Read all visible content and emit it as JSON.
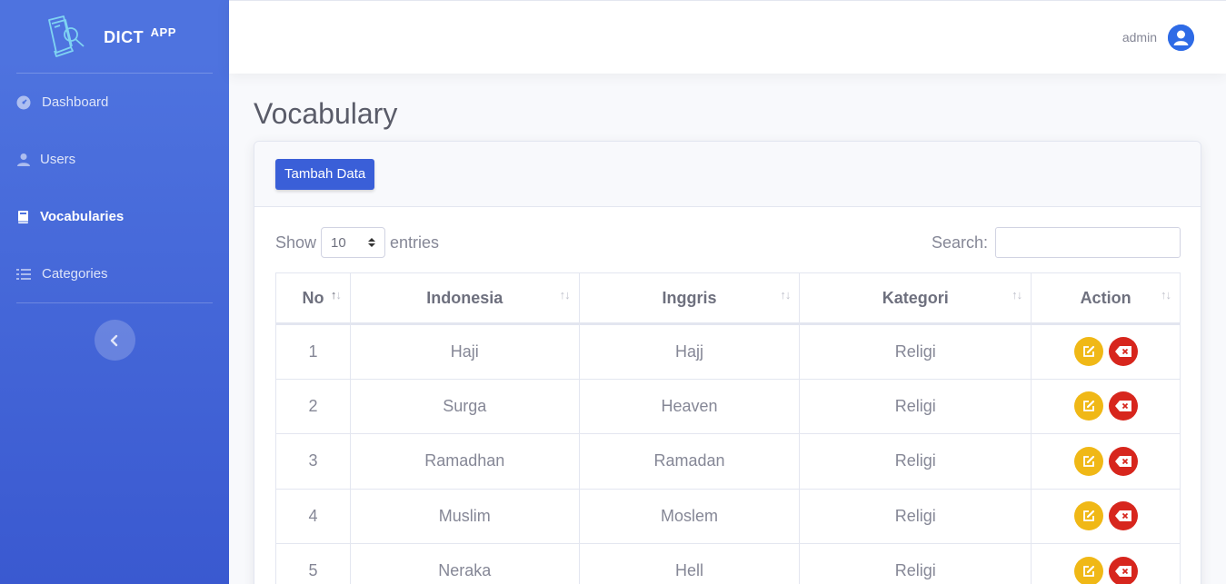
{
  "app": {
    "brand": "DICT",
    "brand_sup": "APP"
  },
  "sidebar": {
    "items": [
      {
        "label": "Dashboard",
        "icon": "gauge-icon",
        "active": false
      },
      {
        "label": "Users",
        "icon": "user-icon",
        "active": false
      },
      {
        "label": "Vocabularies",
        "icon": "book-icon",
        "active": true
      },
      {
        "label": "Categories",
        "icon": "list-icon",
        "active": false
      }
    ],
    "toggle_icon": "chevron-left-icon"
  },
  "topbar": {
    "username": "admin",
    "avatar_icon": "user-circle-icon"
  },
  "page": {
    "title": "Vocabulary"
  },
  "card": {
    "add_button": "Tambah Data"
  },
  "table_controls": {
    "show_label": "Show",
    "entries_value": "10",
    "entries_label": "entries",
    "search_label": "Search:",
    "search_value": ""
  },
  "table": {
    "columns": [
      "No",
      "Indonesia",
      "Inggris",
      "Kategori",
      "Action"
    ],
    "rows": [
      {
        "no": "1",
        "indonesia": "Haji",
        "inggris": "Hajj",
        "kategori": "Religi"
      },
      {
        "no": "2",
        "indonesia": "Surga",
        "inggris": "Heaven",
        "kategori": "Religi"
      },
      {
        "no": "3",
        "indonesia": "Ramadhan",
        "inggris": "Ramadan",
        "kategori": "Religi"
      },
      {
        "no": "4",
        "indonesia": "Muslim",
        "inggris": "Moslem",
        "kategori": "Religi"
      },
      {
        "no": "5",
        "indonesia": "Neraka",
        "inggris": "Hell",
        "kategori": "Religi"
      }
    ]
  },
  "colors": {
    "sidebar": "#4e73df",
    "edit_button": "#f0b816",
    "delete_button": "#d7261d",
    "primary_button": "#3a5fd8"
  }
}
